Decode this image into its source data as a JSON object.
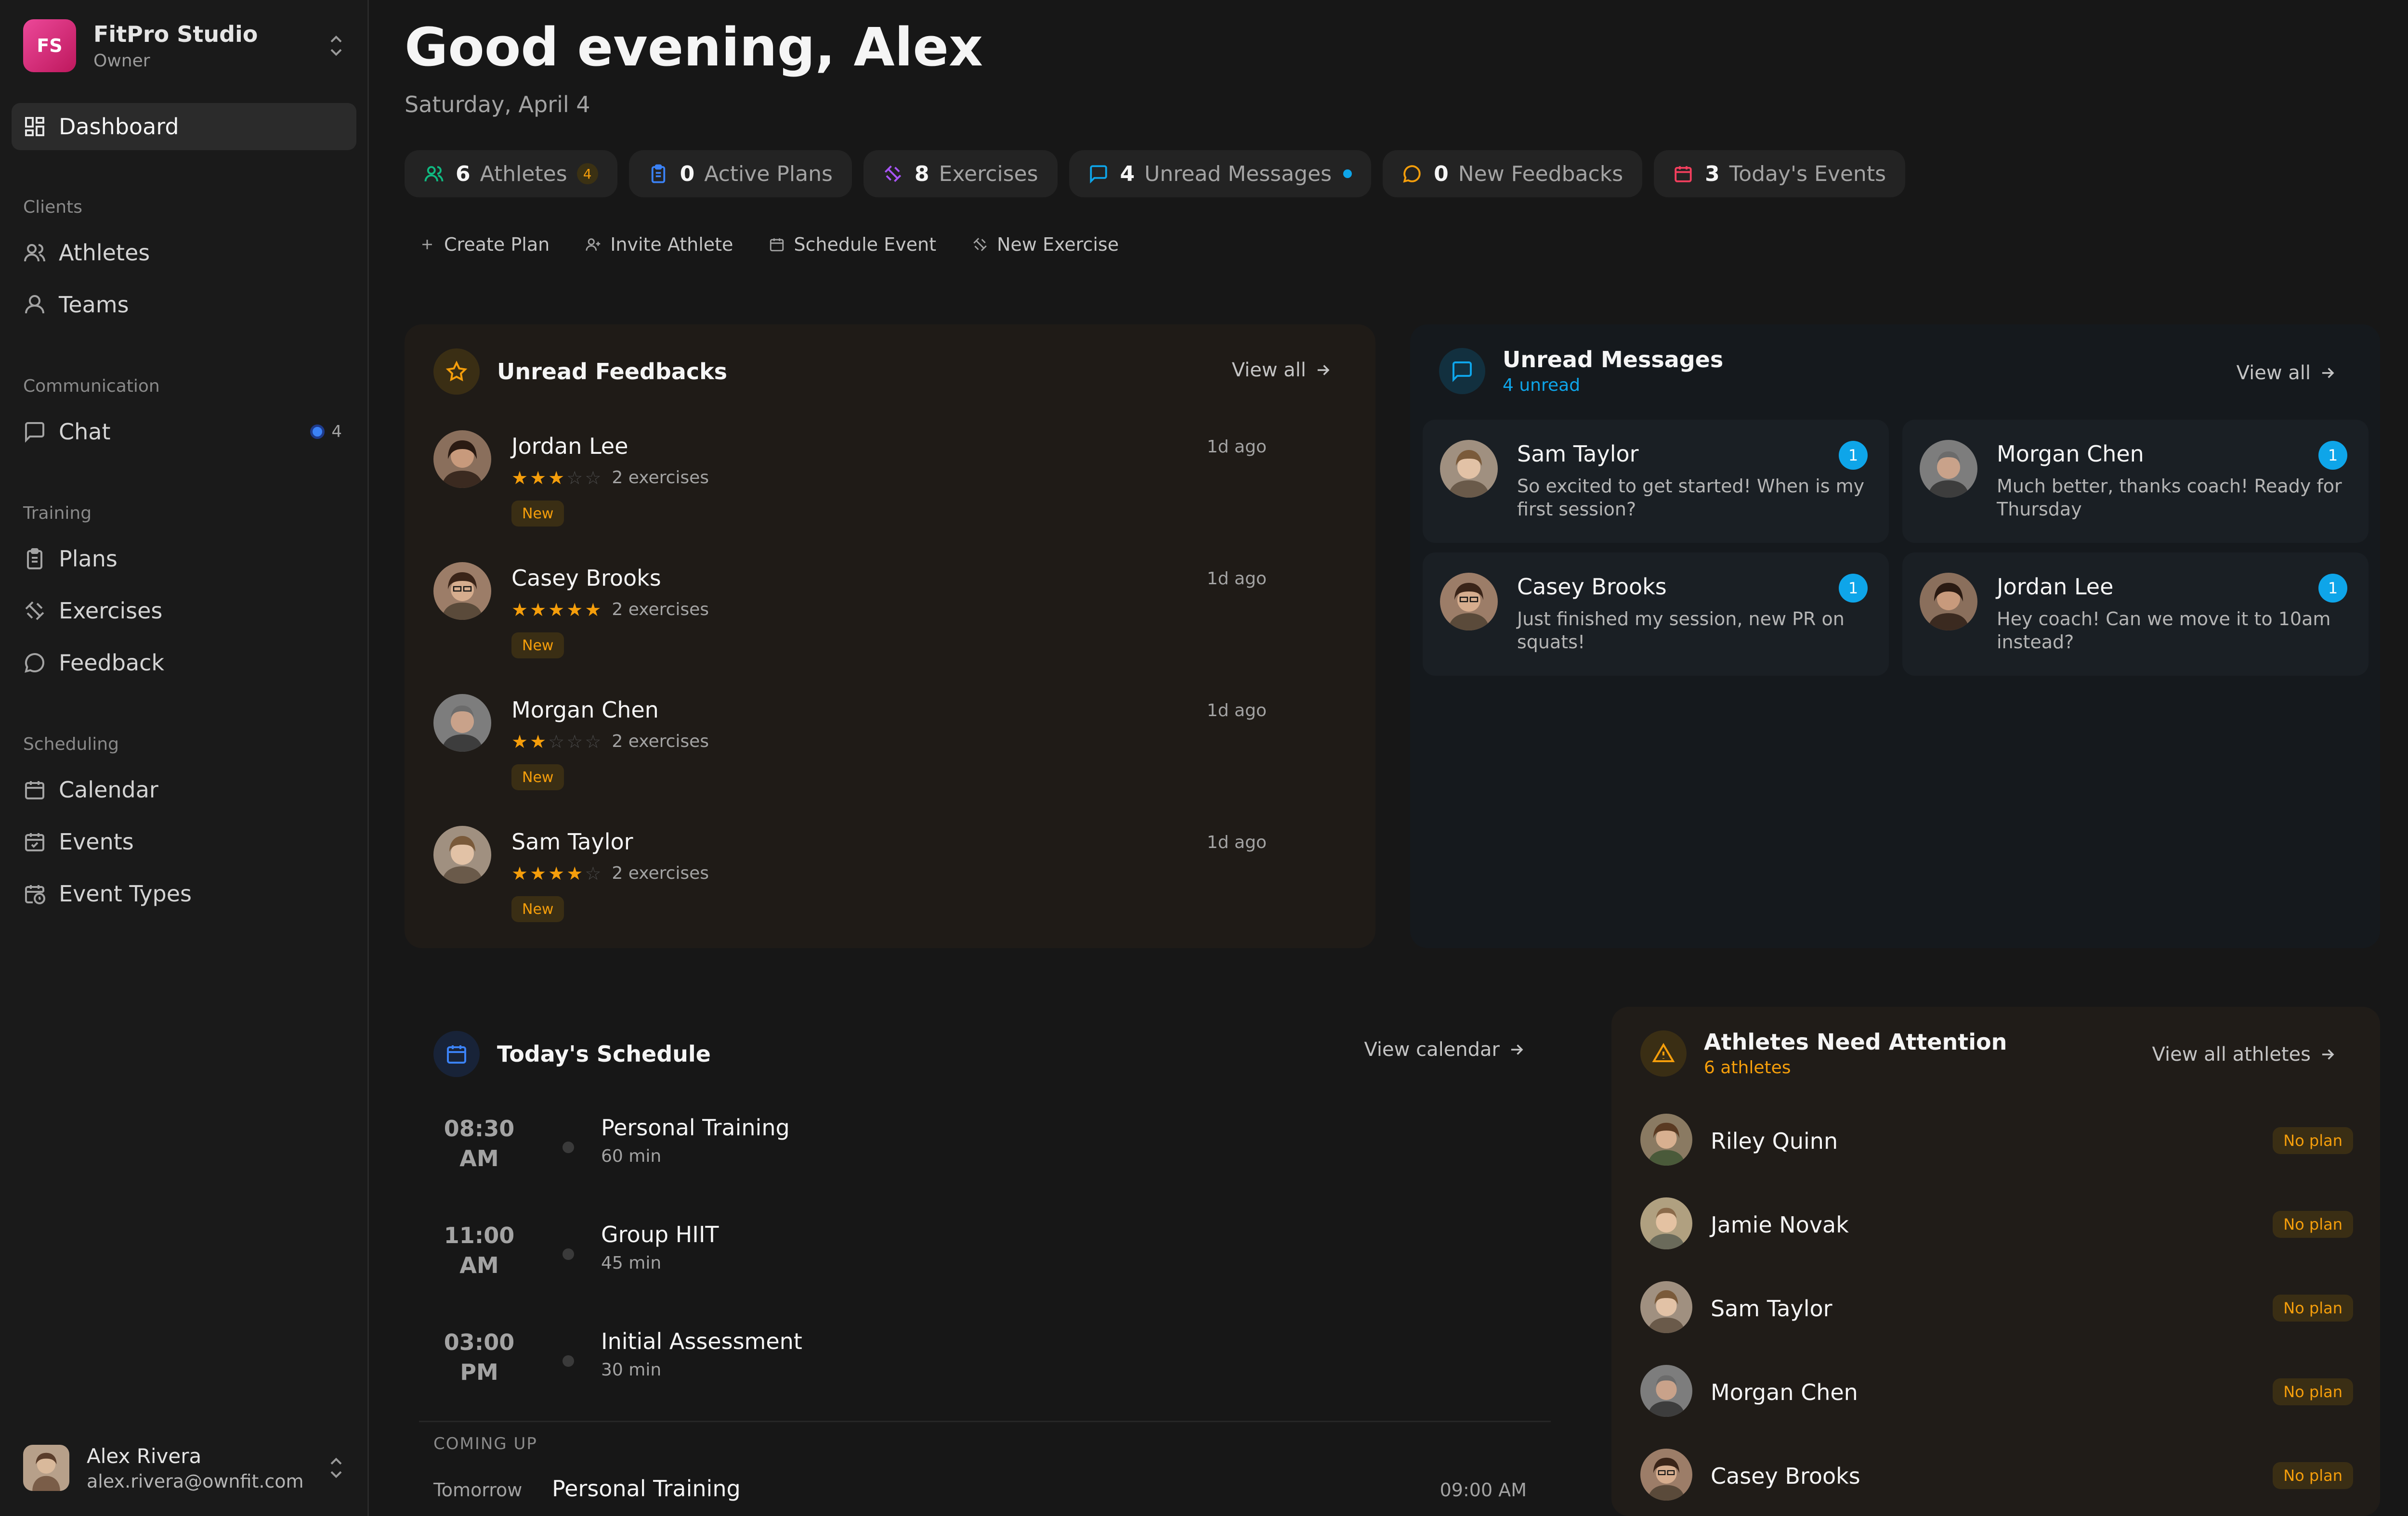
{
  "sidebar": {
    "workspace": {
      "initials": "FS",
      "name": "FitPro Studio",
      "role": "Owner"
    },
    "dashboard_label": "Dashboard",
    "sections": {
      "clients": "Clients",
      "communication": "Communication",
      "training": "Training",
      "scheduling": "Scheduling"
    },
    "items": {
      "athletes": "Athletes",
      "teams": "Teams",
      "chat": "Chat",
      "chat_count": "4",
      "plans": "Plans",
      "exercises": "Exercises",
      "feedback": "Feedback",
      "calendar": "Calendar",
      "events": "Events",
      "event_types": "Event Types"
    },
    "user": {
      "name": "Alex Rivera",
      "email": "alex.rivera@ownfit.com"
    }
  },
  "header": {
    "greeting": "Good evening, Alex",
    "date": "Saturday, April 4"
  },
  "stats": [
    {
      "num": "6",
      "label": "Athletes",
      "badge": "4",
      "icon": "users-icon",
      "color": "#10b981"
    },
    {
      "num": "0",
      "label": "Active Plans",
      "icon": "clipboard-icon",
      "color": "#3b82f6"
    },
    {
      "num": "8",
      "label": "Exercises",
      "icon": "dumbbell-icon",
      "color": "#a855f7"
    },
    {
      "num": "4",
      "label": "Unread Messages",
      "icon": "message-square-icon",
      "color": "#0ea5e9"
    },
    {
      "num": "0",
      "label": "New Feedbacks",
      "icon": "message-circle-icon",
      "color": "#f59e0b"
    },
    {
      "num": "3",
      "label": "Today's Events",
      "icon": "calendar-icon",
      "color": "#f43f5e"
    }
  ],
  "quick_actions": {
    "create_plan": "Create Plan",
    "invite_athlete": "Invite Athlete",
    "schedule_event": "Schedule Event",
    "new_exercise": "New Exercise"
  },
  "feedbacks": {
    "title": "Unread Feedbacks",
    "view_all": "View all",
    "items": [
      {
        "name": "Jordan Lee",
        "rating": 3,
        "exercises": "2 exercises",
        "badge": "New",
        "time": "1d ago"
      },
      {
        "name": "Casey Brooks",
        "rating": 5,
        "exercises": "2 exercises",
        "badge": "New",
        "time": "1d ago"
      },
      {
        "name": "Morgan Chen",
        "rating": 2,
        "exercises": "2 exercises",
        "badge": "New",
        "time": "1d ago"
      },
      {
        "name": "Sam Taylor",
        "rating": 4,
        "exercises": "2 exercises",
        "badge": "New",
        "time": "1d ago"
      }
    ]
  },
  "messages": {
    "title": "Unread Messages",
    "subtitle": "4 unread",
    "view_all": "View all",
    "items": [
      {
        "name": "Sam Taylor",
        "count": "1",
        "text": "So excited to get started! When is my first session?"
      },
      {
        "name": "Morgan Chen",
        "count": "1",
        "text": "Much better, thanks coach! Ready for Thursday"
      },
      {
        "name": "Casey Brooks",
        "count": "1",
        "text": "Just finished my session, new PR on squats!"
      },
      {
        "name": "Jordan Lee",
        "count": "1",
        "text": "Hey coach! Can we move it to 10am instead?"
      }
    ]
  },
  "schedule": {
    "title": "Today's Schedule",
    "view_calendar": "View calendar",
    "items": [
      {
        "time": "08:30",
        "ampm": "AM",
        "title": "Personal Training",
        "duration": "60 min"
      },
      {
        "time": "11:00",
        "ampm": "AM",
        "title": "Group HIIT",
        "duration": "45 min"
      },
      {
        "time": "03:00",
        "ampm": "PM",
        "title": "Initial Assessment",
        "duration": "30 min"
      }
    ],
    "coming_up_label": "COMING UP",
    "coming": {
      "day": "Tomorrow",
      "title": "Personal Training",
      "time": "09:00 AM"
    }
  },
  "attention": {
    "title": "Athletes Need Attention",
    "subtitle": "6 athletes",
    "view_all": "View all athletes",
    "items": [
      {
        "name": "Riley Quinn",
        "badge": "No plan"
      },
      {
        "name": "Jamie Novak",
        "badge": "No plan"
      },
      {
        "name": "Sam Taylor",
        "badge": "No plan"
      },
      {
        "name": "Morgan Chen",
        "badge": "No plan"
      },
      {
        "name": "Casey Brooks",
        "badge": "No plan"
      }
    ]
  }
}
